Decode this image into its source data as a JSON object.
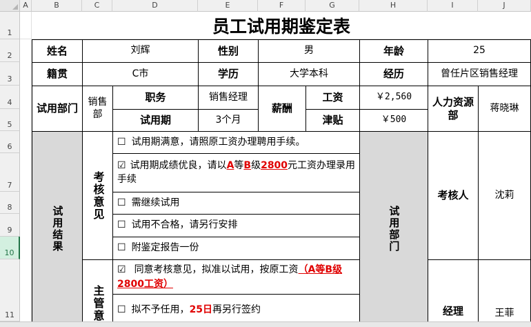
{
  "sheet": {
    "columns": [
      "A",
      "B",
      "C",
      "D",
      "E",
      "F",
      "G",
      "H",
      "I",
      "J"
    ],
    "rows": [
      "1",
      "2",
      "3",
      "4",
      "5",
      "6",
      "7",
      "8",
      "9",
      "10",
      "11"
    ]
  },
  "title": "员工试用期鉴定表",
  "labels": {
    "name": "姓名",
    "gender": "性别",
    "age": "年龄",
    "native": "籍贯",
    "education": "学历",
    "experience": "经历",
    "dept": "试用部门",
    "position": "职务",
    "salary_group": "薪酬",
    "base_salary": "工资",
    "allowance": "津贴",
    "hr_dept": "人力资源部",
    "period": "试用期",
    "result": "试用结果",
    "review_opinion": "考核意见",
    "trial_dept": "试用部门",
    "reviewer": "考核人",
    "manager": "经理",
    "supervisor_opinion": "主管意"
  },
  "values": {
    "name": "刘辉",
    "gender": "男",
    "age": "25",
    "native": "C市",
    "education": "大学本科",
    "experience": "曾任片区销售经理",
    "dept": "销售部",
    "position": "销售经理",
    "base_salary": "￥2,560",
    "allowance": "￥500",
    "hr_person": "蒋晓琳",
    "period": "3个月",
    "reviewer_name": "沈莉",
    "manager_name": "王菲"
  },
  "review_options": [
    {
      "mark": "☐",
      "text": "试用期满意，请照原工资办理聘用手续。"
    },
    {
      "mark": "☑",
      "pre": "试用期成绩优良，请以",
      "a": "A",
      "mid1": "等",
      "bb": "B",
      "mid2": "级",
      "amount": "2800",
      "post": "元工资办理录用手续"
    },
    {
      "mark": "☐",
      "text": "需继续试用"
    },
    {
      "mark": "☐",
      "text": "试用不合格，请另行安排"
    },
    {
      "mark": "☐",
      "text": "附鉴定报告一份"
    }
  ],
  "supervisor_options": [
    {
      "mark": "☑",
      "pre": "同意考核意见，拟准以试用，按原工资",
      "red": "（A等B级2800工资）"
    },
    {
      "mark": "☐",
      "pre": "拟不予任用，",
      "red": "25日",
      "post": "再另行签约"
    }
  ]
}
